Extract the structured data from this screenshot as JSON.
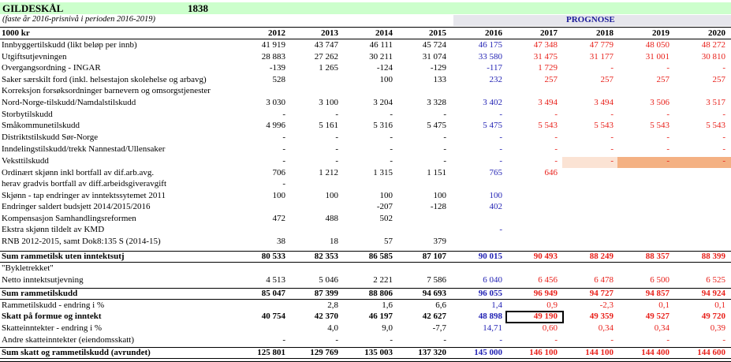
{
  "header": {
    "title": "GILDESKÅL",
    "code": "1838",
    "subtitle": "(faste år 2016-prisnivå i perioden 2016-2019)",
    "prognose_label": "PROGNOSE",
    "unit_label": "1000 kr",
    "years": [
      "2012",
      "2013",
      "2014",
      "2015",
      "2016",
      "2017",
      "2018",
      "2019",
      "2020"
    ]
  },
  "colors": {
    "title_bg": "#ccffcc",
    "prognose_bg": "#e6e6ec",
    "prognose_text": "#1b1b9a",
    "historic_2016": "#2323b4",
    "forecast": "#e8201a",
    "highlight_light": "#fbe3d4",
    "highlight_orange": "#f4b183"
  },
  "rows": [
    {
      "label": "Innbyggertilskudd (likt beløp per innb)",
      "values": [
        "41 919",
        "43 747",
        "46 111",
        "45 724",
        "46 175",
        "47 348",
        "47 779",
        "48 050",
        "48 272"
      ]
    },
    {
      "label": "Utgiftsutjevningen",
      "values": [
        "28 883",
        "27 262",
        "30 211",
        "31 074",
        "33 580",
        "31 475",
        "31 177",
        "31 001",
        "30 810"
      ]
    },
    {
      "label": "Overgangsordning - INGAR",
      "values": [
        "-139",
        "1 265",
        "-124",
        "-129",
        "-117",
        "1 729",
        "-",
        "-",
        "-"
      ]
    },
    {
      "label": "Saker særskilt ford (inkl. helsestajon skolehelse og arbavg)",
      "values": [
        "528",
        "",
        "100",
        "133",
        "232",
        "257",
        "257",
        "257",
        "257"
      ]
    },
    {
      "label": "Korreksjon forsøksordninger barnevern og omsorgstjenester",
      "values": [
        "",
        "",
        "",
        "",
        "",
        "",
        "",
        "",
        ""
      ]
    },
    {
      "label": "Nord-Norge-tilskudd/Namdalstilskudd",
      "values": [
        "3 030",
        "3 100",
        "3 204",
        "3 328",
        "3 402",
        "3 494",
        "3 494",
        "3 506",
        "3 517"
      ]
    },
    {
      "label": "Storbytilskudd",
      "values": [
        "-",
        "-",
        "-",
        "-",
        "-",
        "-",
        "-",
        "-",
        "-"
      ]
    },
    {
      "label": "Småkommunetilskudd",
      "values": [
        "4 996",
        "5 161",
        "5 316",
        "5 475",
        "5 475",
        "5 543",
        "5 543",
        "5 543",
        "5 543"
      ]
    },
    {
      "label": "Distriktstilskudd Sør-Norge",
      "values": [
        "-",
        "-",
        "-",
        "-",
        "-",
        "-",
        "-",
        "-",
        "-"
      ]
    },
    {
      "label": "Inndelingstilskudd/trekk Nannestad/Ullensaker",
      "values": [
        "-",
        "-",
        "-",
        "-",
        "-",
        "-",
        "-",
        "-",
        "-"
      ]
    },
    {
      "label": "Veksttilskudd",
      "values": [
        "-",
        "-",
        "-",
        "-",
        "-",
        "-",
        "-",
        "-",
        "-"
      ]
    },
    {
      "label": "Ordinært skjønn inkl bortfall av dif.arb.avg.",
      "values": [
        "706",
        "1 212",
        "1 315",
        "1 151",
        "765",
        "646",
        "",
        "",
        ""
      ]
    },
    {
      "label": " herav gradvis bortfall av diff.arbeidsgiveravgift",
      "values": [
        "-",
        "",
        "",
        "",
        "",
        "",
        "",
        "",
        ""
      ]
    },
    {
      "label": "Skjønn - tap endringer av inntektssytemet 2011",
      "values": [
        "100",
        "100",
        "100",
        "100",
        "100",
        "",
        "",
        "",
        ""
      ]
    },
    {
      "label": "Endringer saldert budsjett 2014/2015/2016",
      "values": [
        "",
        "",
        "-207",
        "-128",
        "402",
        "",
        "",
        "",
        ""
      ]
    },
    {
      "label": "Kompensasjon Samhandlingsreformen",
      "values": [
        "472",
        "488",
        "502",
        "",
        "",
        "",
        "",
        "",
        ""
      ]
    },
    {
      "label": "Ekstra skjønn tildelt av KMD",
      "values": [
        "",
        "",
        "",
        "",
        "-",
        "",
        "",
        "",
        ""
      ]
    },
    {
      "label": "RNB 2012-2015, samt Dok8:135 S (2014-15)",
      "values": [
        "38",
        "18",
        "57",
        "379",
        "",
        "",
        "",
        "",
        ""
      ]
    },
    {
      "label": "Sum rammetilsk uten inntektsutj",
      "values": [
        "80 533",
        "82 353",
        "86 585",
        "87 107",
        "90 015",
        "90 493",
        "88 249",
        "88 357",
        "88 399"
      ]
    },
    {
      "label": "\"Bykletrekket\"",
      "values": [
        "",
        "",
        "",
        "",
        "",
        "",
        "",
        "",
        ""
      ]
    },
    {
      "label": "Netto inntektsutjevning",
      "values": [
        "4 513",
        "5 046",
        "2 221",
        "7 586",
        "6 040",
        "6 456",
        "6 478",
        "6 500",
        "6 525"
      ]
    },
    {
      "label": "Sum rammetilskudd",
      "values": [
        "85 047",
        "87 399",
        "88 806",
        "94 693",
        "96 055",
        "96 949",
        "94 727",
        "94 857",
        "94 924"
      ]
    },
    {
      "label": "Rammetilskudd - endring i %",
      "values": [
        "",
        "2,8",
        "1,6",
        "6,6",
        "1,4",
        "0,9",
        "-2,3",
        "0,1",
        "0,1"
      ]
    },
    {
      "label": "Skatt på formue og inntekt",
      "values": [
        "40 754",
        "42 370",
        "46 197",
        "42 627",
        "48 898",
        "49 190",
        "49 359",
        "49 527",
        "49 720"
      ]
    },
    {
      "label": "Skatteinntekter - endring i %",
      "values": [
        "",
        "4,0",
        "9,0",
        "-7,7",
        "14,71",
        "0,60",
        "0,34",
        "0,34",
        "0,39"
      ]
    },
    {
      "label": "Andre skatteinntekter (eiendomsskatt)",
      "values": [
        "-",
        "-",
        "-",
        "-",
        "-",
        "-",
        "-",
        "-",
        "-"
      ]
    },
    {
      "label": "Sum skatt og rammetilskudd (avrundet)",
      "values": [
        "125 801",
        "129 769",
        "135 003",
        "137 320",
        "145 000",
        "146 100",
        "144 100",
        "144 400",
        "144 600"
      ]
    }
  ]
}
